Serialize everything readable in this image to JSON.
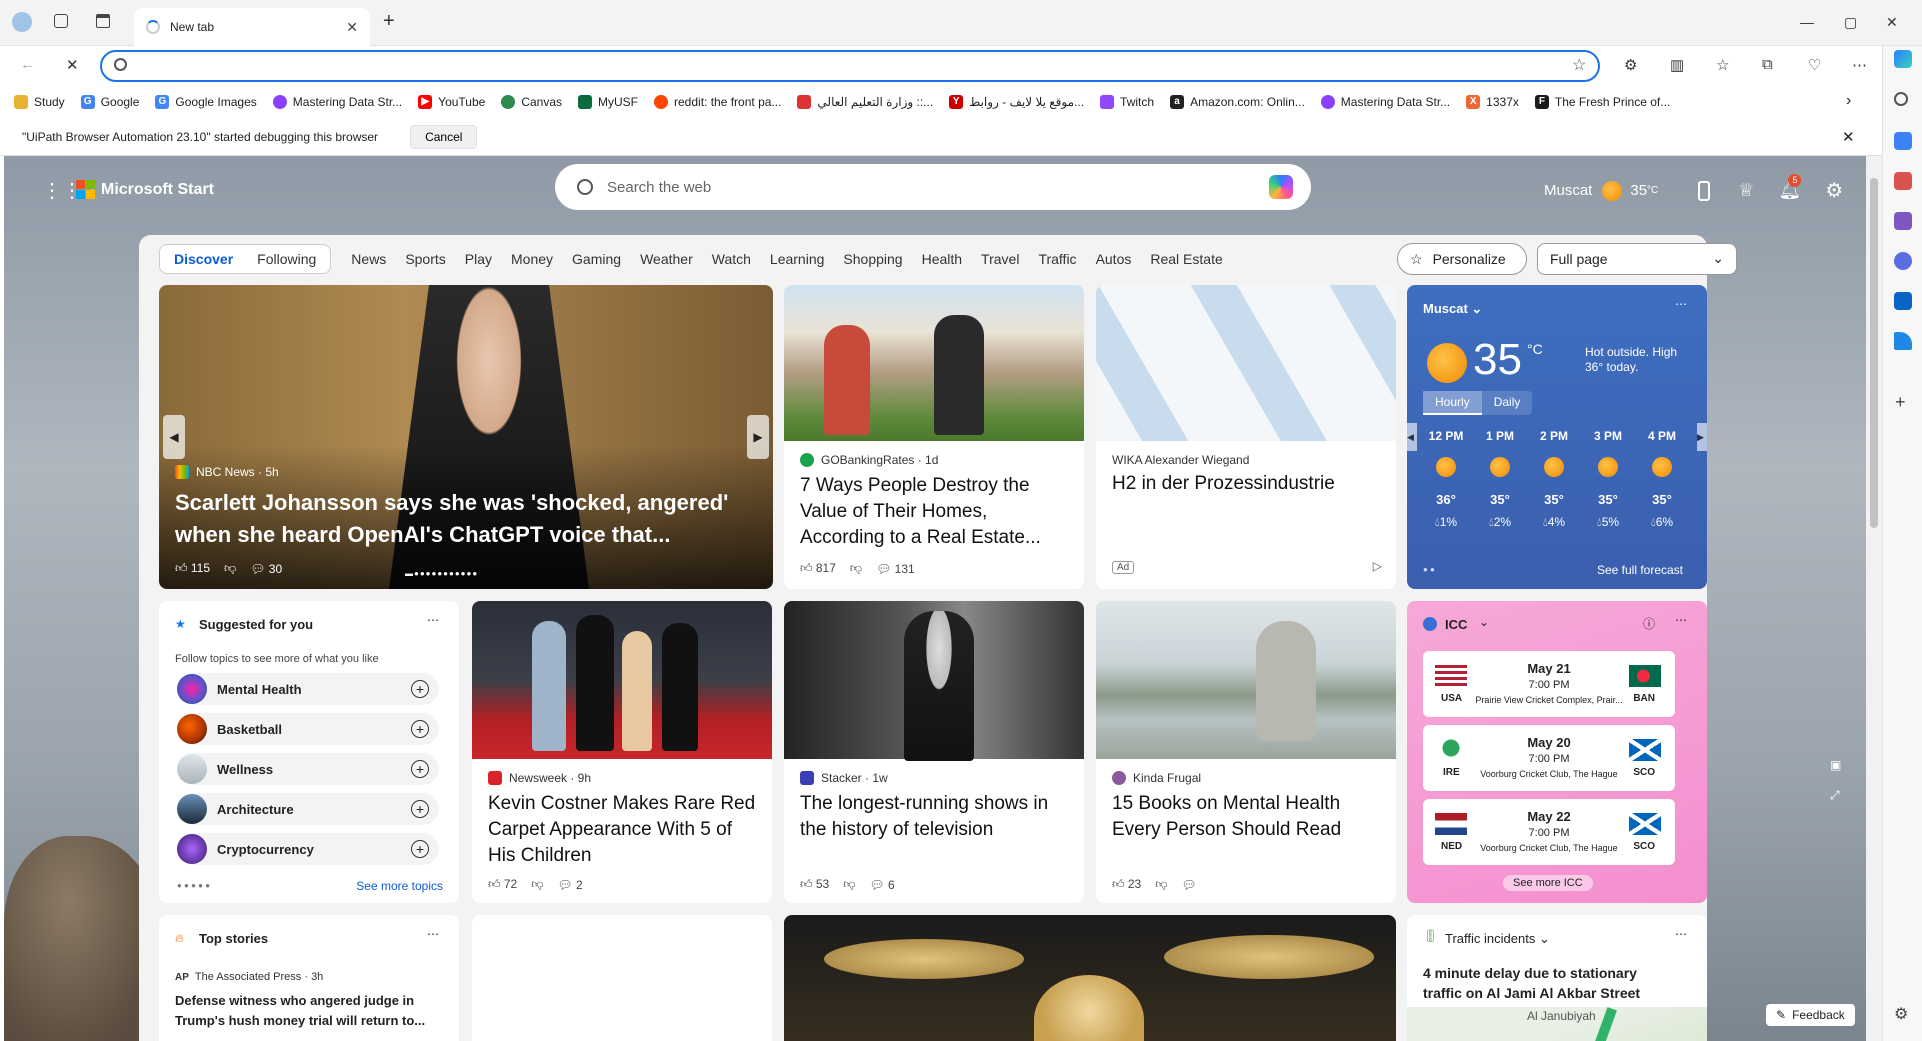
{
  "tab": {
    "title": "New tab"
  },
  "window": {
    "minimize": "—",
    "maximize": "▢",
    "close": "✕"
  },
  "bookmarks": [
    {
      "label": "Study",
      "color": "#e7b332"
    },
    {
      "label": "Google",
      "color": "#4285f4"
    },
    {
      "label": "Google Images",
      "color": "#4285f4"
    },
    {
      "label": "Mastering Data Str...",
      "color": "#8a3ffc"
    },
    {
      "label": "YouTube",
      "color": "#ff0000"
    },
    {
      "label": "Canvas",
      "color": "#2d8a4e"
    },
    {
      "label": "MyUSF",
      "color": "#0b6b3a"
    },
    {
      "label": "reddit: the front pa...",
      "color": "#ff4500"
    },
    {
      "label": "وزارة التعليم العالي ::...",
      "color": "#d33"
    },
    {
      "label": "موقع يلا لايف - روابط...",
      "color": "#c00"
    },
    {
      "label": "Twitch",
      "color": "#9146ff"
    },
    {
      "label": "Amazon.com: Onlin...",
      "color": "#222"
    },
    {
      "label": "Mastering Data Str...",
      "color": "#8a3ffc"
    },
    {
      "label": "1337x",
      "color": "#e63"
    },
    {
      "label": "The Fresh Prince of...",
      "color": "#1a1a1a"
    }
  ],
  "infobar": {
    "message": "\"UiPath Browser Automation 23.10\" started debugging this browser",
    "cancel": "Cancel"
  },
  "header": {
    "brand": "Microsoft Start",
    "search_placeholder": "Search the web",
    "city": "Muscat",
    "temp": "35",
    "unit": "°C",
    "notifications": "5"
  },
  "nav": {
    "discover": "Discover",
    "following": "Following",
    "links": [
      "News",
      "Sports",
      "Play",
      "Money",
      "Gaming",
      "Weather",
      "Watch",
      "Learning",
      "Shopping",
      "Health",
      "Travel",
      "Traffic",
      "Autos",
      "Real Estate"
    ],
    "personalize": "Personalize",
    "layout": "Full page"
  },
  "hero": {
    "source": "NBC News · 5h",
    "title": "Scarlett Johansson says she was 'shocked, angered' when she heard OpenAI's ChatGPT voice that...",
    "likes": "115",
    "comments": "30"
  },
  "card2": {
    "source": "GOBankingRates · 1d",
    "title": "7 Ways People Destroy the Value of Their Homes, According to a Real Estate...",
    "likes": "817",
    "comments": "131"
  },
  "ad": {
    "source": "WIKA Alexander Wiegand",
    "title": "H2 in der Prozessindustrie",
    "badge": "Ad"
  },
  "weather": {
    "city": "Muscat",
    "temp": "35",
    "unit": "°C",
    "desc": "Hot outside. High 36° today.",
    "tab_hourly": "Hourly",
    "tab_daily": "Daily",
    "hours": [
      {
        "time": "12 PM",
        "temp": "36°",
        "rain": "1%"
      },
      {
        "time": "1 PM",
        "temp": "35°",
        "rain": "2%"
      },
      {
        "time": "2 PM",
        "temp": "35°",
        "rain": "4%"
      },
      {
        "time": "3 PM",
        "temp": "35°",
        "rain": "5%"
      },
      {
        "time": "4 PM",
        "temp": "35°",
        "rain": "6%"
      }
    ],
    "forecast_link": "See full forecast"
  },
  "suggested": {
    "title": "Suggested for you",
    "subtitle": "Follow topics to see more of what you like",
    "topics": [
      "Mental Health",
      "Basketball",
      "Wellness",
      "Architecture",
      "Cryptocurrency"
    ],
    "more": "See more topics"
  },
  "card5": {
    "source": "Newsweek · 9h",
    "title": "Kevin Costner Makes Rare Red Carpet Appearance With 5 of His Children",
    "likes": "72",
    "comments": "2"
  },
  "card6": {
    "source": "Stacker · 1w",
    "title": "The longest-running shows in the history of television",
    "likes": "53",
    "comments": "6"
  },
  "card7": {
    "source": "Kinda Frugal",
    "title": "15 Books on Mental Health Every Person Should Read",
    "likes": "23"
  },
  "icc": {
    "title": "ICC",
    "matches": [
      {
        "date": "May 21",
        "time": "7:00 PM",
        "venue": "Prairie View Cricket Complex, Prair...",
        "home": "USA",
        "away": "BAN"
      },
      {
        "date": "May 20",
        "time": "7:00 PM",
        "venue": "Voorburg Cricket Club, The Hague",
        "home": "IRE",
        "away": "SCO"
      },
      {
        "date": "May 22",
        "time": "7:00 PM",
        "venue": "Voorburg Cricket Club, The Hague",
        "home": "NED",
        "away": "SCO"
      }
    ],
    "more": "See more ICC"
  },
  "topstories": {
    "title": "Top stories",
    "source": "The Associated Press · 3h",
    "headline": "Defense witness who angered judge in Trump's hush money trial will return to..."
  },
  "traffic": {
    "title": "Traffic incidents",
    "headline": "4 minute delay due to stationary traffic on Al Jami Al Akbar Street",
    "map_label": "Al Janubiyah"
  },
  "feedback": "Feedback"
}
